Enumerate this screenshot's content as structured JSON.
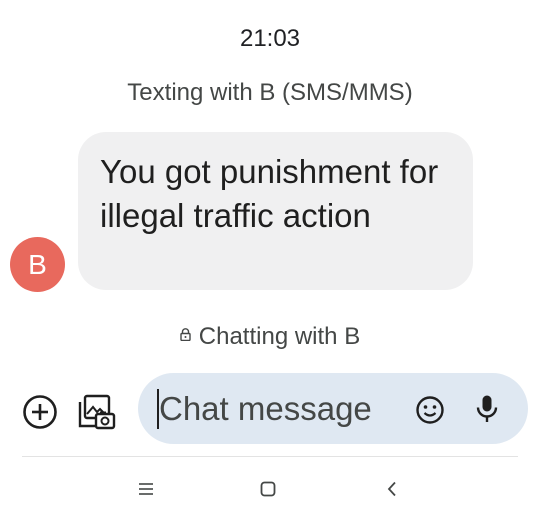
{
  "status": {
    "time": "21:03"
  },
  "thread": {
    "info": "Texting with B (SMS/MMS)"
  },
  "message": {
    "sender_initial": "B",
    "text": "You got punishment for illegal traffic action"
  },
  "chat_banner": {
    "text": "Chatting with B"
  },
  "composer": {
    "placeholder": "Chat message"
  },
  "icons": {
    "add": "plus-circle-icon",
    "gallery": "gallery-icon",
    "emoji": "emoji-icon",
    "mic": "microphone-icon",
    "lock": "lock-icon",
    "recents": "recents-icon",
    "home": "home-icon",
    "back": "back-icon"
  },
  "colors": {
    "avatar": "#e8695d",
    "bubble": "#f0f0f1",
    "composer": "#dfe8f2"
  }
}
